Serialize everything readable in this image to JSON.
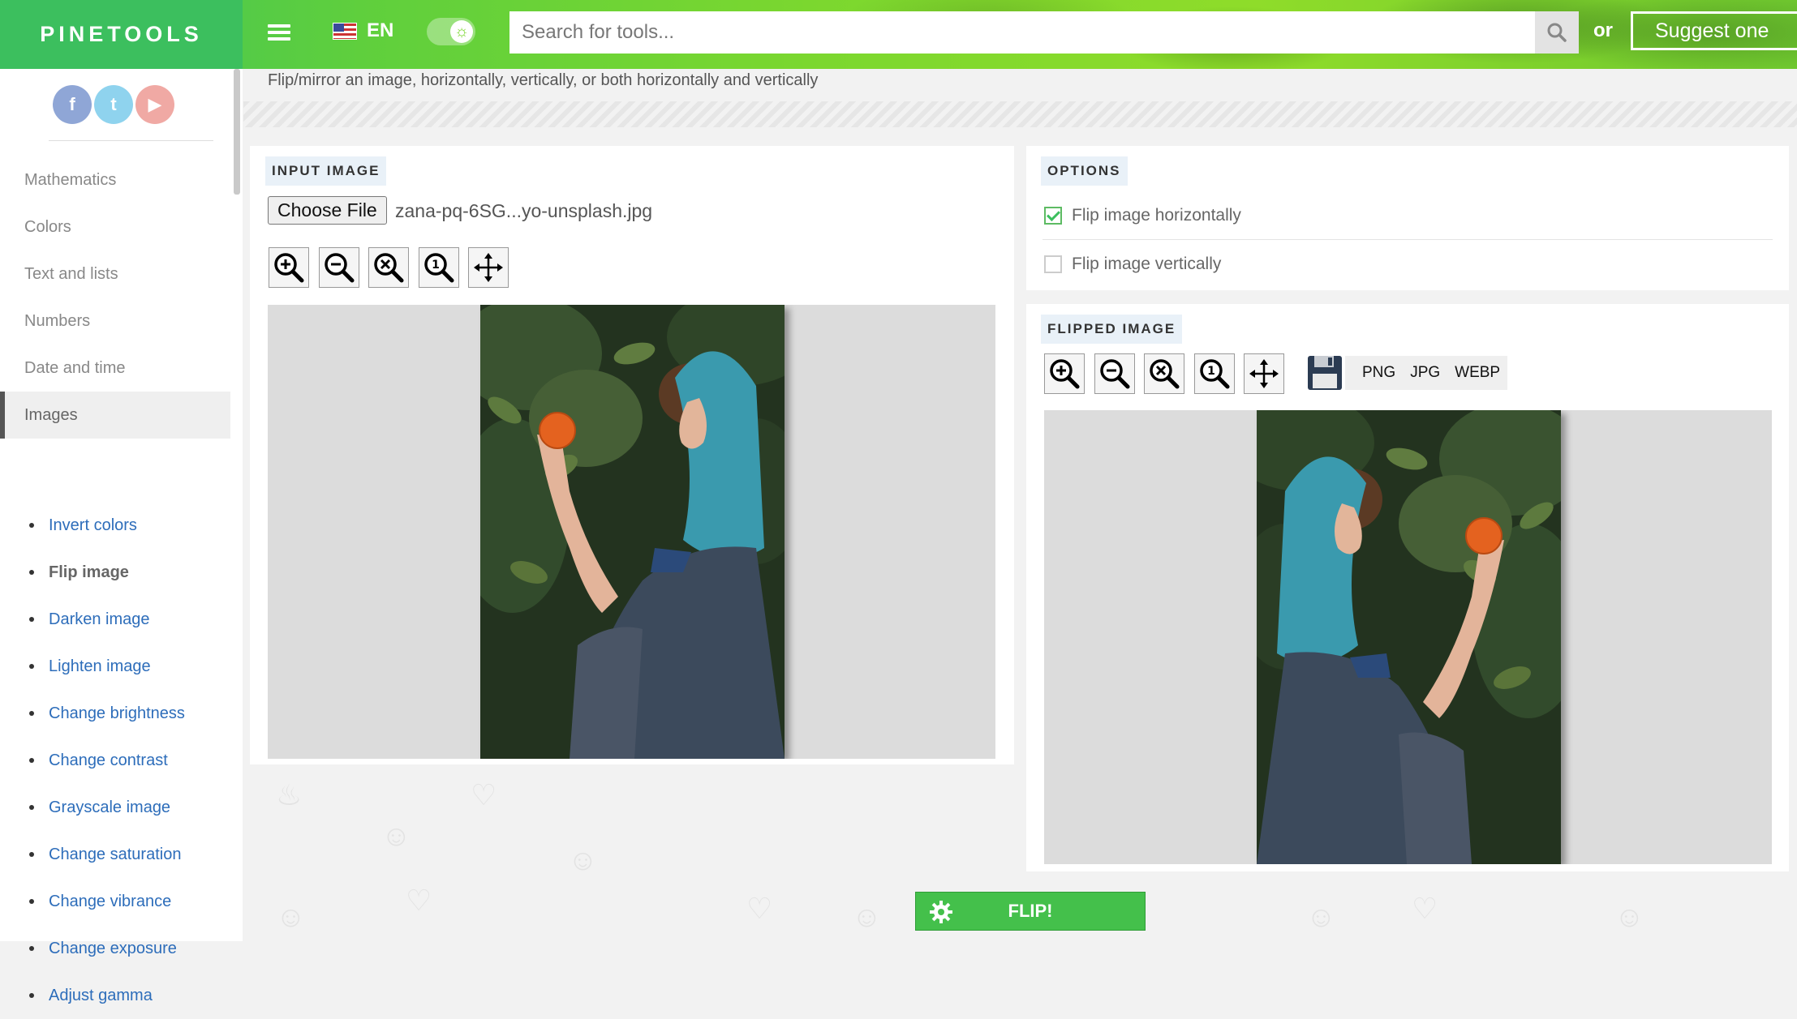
{
  "header": {
    "logo": "PINETOOLS",
    "language": "EN",
    "search_placeholder": "Search for tools...",
    "or_text": "or",
    "suggest_label": "Suggest one"
  },
  "sidebar": {
    "social": [
      "f",
      "t",
      "▶"
    ],
    "categories": [
      "Mathematics",
      "Colors",
      "Text and lists",
      "Numbers",
      "Date and time",
      "Images"
    ],
    "tools": [
      "Invert colors",
      "Flip image",
      "Darken image",
      "Lighten image",
      "Change brightness",
      "Change contrast",
      "Grayscale image",
      "Change saturation",
      "Change vibrance",
      "Change exposure",
      "Adjust gamma"
    ]
  },
  "page": {
    "description": "Flip/mirror an image, horizontally, vertically, or both horizontally and vertically"
  },
  "input": {
    "title": "INPUT IMAGE",
    "choose_file": "Choose File",
    "file_name": "zana-pq-6SG...yo-unsplash.jpg"
  },
  "options": {
    "title": "OPTIONS",
    "flip_horizontal": "Flip image horizontally",
    "flip_horizontal_checked": true,
    "flip_vertical": "Flip image vertically",
    "flip_vertical_checked": false
  },
  "output": {
    "title": "FLIPPED IMAGE",
    "formats": [
      "PNG",
      "JPG",
      "WEBP"
    ]
  },
  "action": {
    "flip_label": "FLIP!"
  },
  "colors": {
    "brand_green": "#3cbf5e",
    "link_blue": "#2d6dba",
    "button_green": "#44c04b"
  }
}
